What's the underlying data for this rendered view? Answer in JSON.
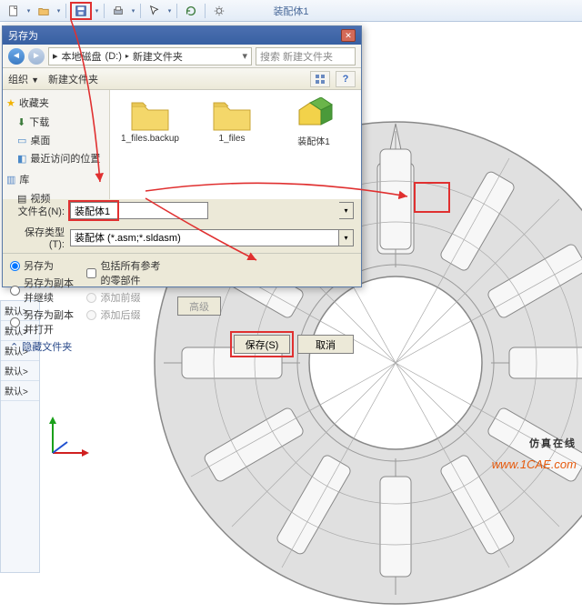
{
  "app": {
    "document_title": "装配体1"
  },
  "toolbar": {
    "icons": [
      "new",
      "open",
      "save",
      "print",
      "arrow",
      "undo",
      "redo"
    ]
  },
  "dialog": {
    "title": "另存为",
    "breadcrumb": {
      "disk": "本地磁盘",
      "drive": "(D:)",
      "folder": "新建文件夹"
    },
    "search_placeholder": "搜索 新建文件夹",
    "organize": "组织",
    "newfolder": "新建文件夹",
    "sidebar": {
      "favorites": "收藏夹",
      "downloads": "下载",
      "desktop": "桌面",
      "recent": "最近访问的位置",
      "libraries": "库",
      "videos": "视频"
    },
    "items": [
      {
        "label": "1_files.backup"
      },
      {
        "label": "1_files"
      },
      {
        "label": "装配体1"
      }
    ],
    "filename_label": "文件名(N):",
    "filename_value": "装配体1",
    "filetype_label": "保存类型(T):",
    "filetype_value": "装配体 (*.asm;*.sldasm)",
    "options": {
      "saveas": "另存为",
      "saveas_copy_cont": "另存为副本并继续",
      "saveas_copy_open": "另存为副本并打开",
      "include_refs": "包括所有参考的零部件",
      "add_prefix": "添加前缀",
      "add_suffix": "添加后缀",
      "advanced": "高级"
    },
    "hide_folders": "隐藏文件夹",
    "save_btn": "保存(S)",
    "cancel_btn": "取消"
  },
  "left_rail": [
    "默认>",
    "默认>",
    "默认>",
    "默认>",
    "默认>"
  ],
  "branding": {
    "text": "仿真在线",
    "url": "www.1CAE.com"
  }
}
